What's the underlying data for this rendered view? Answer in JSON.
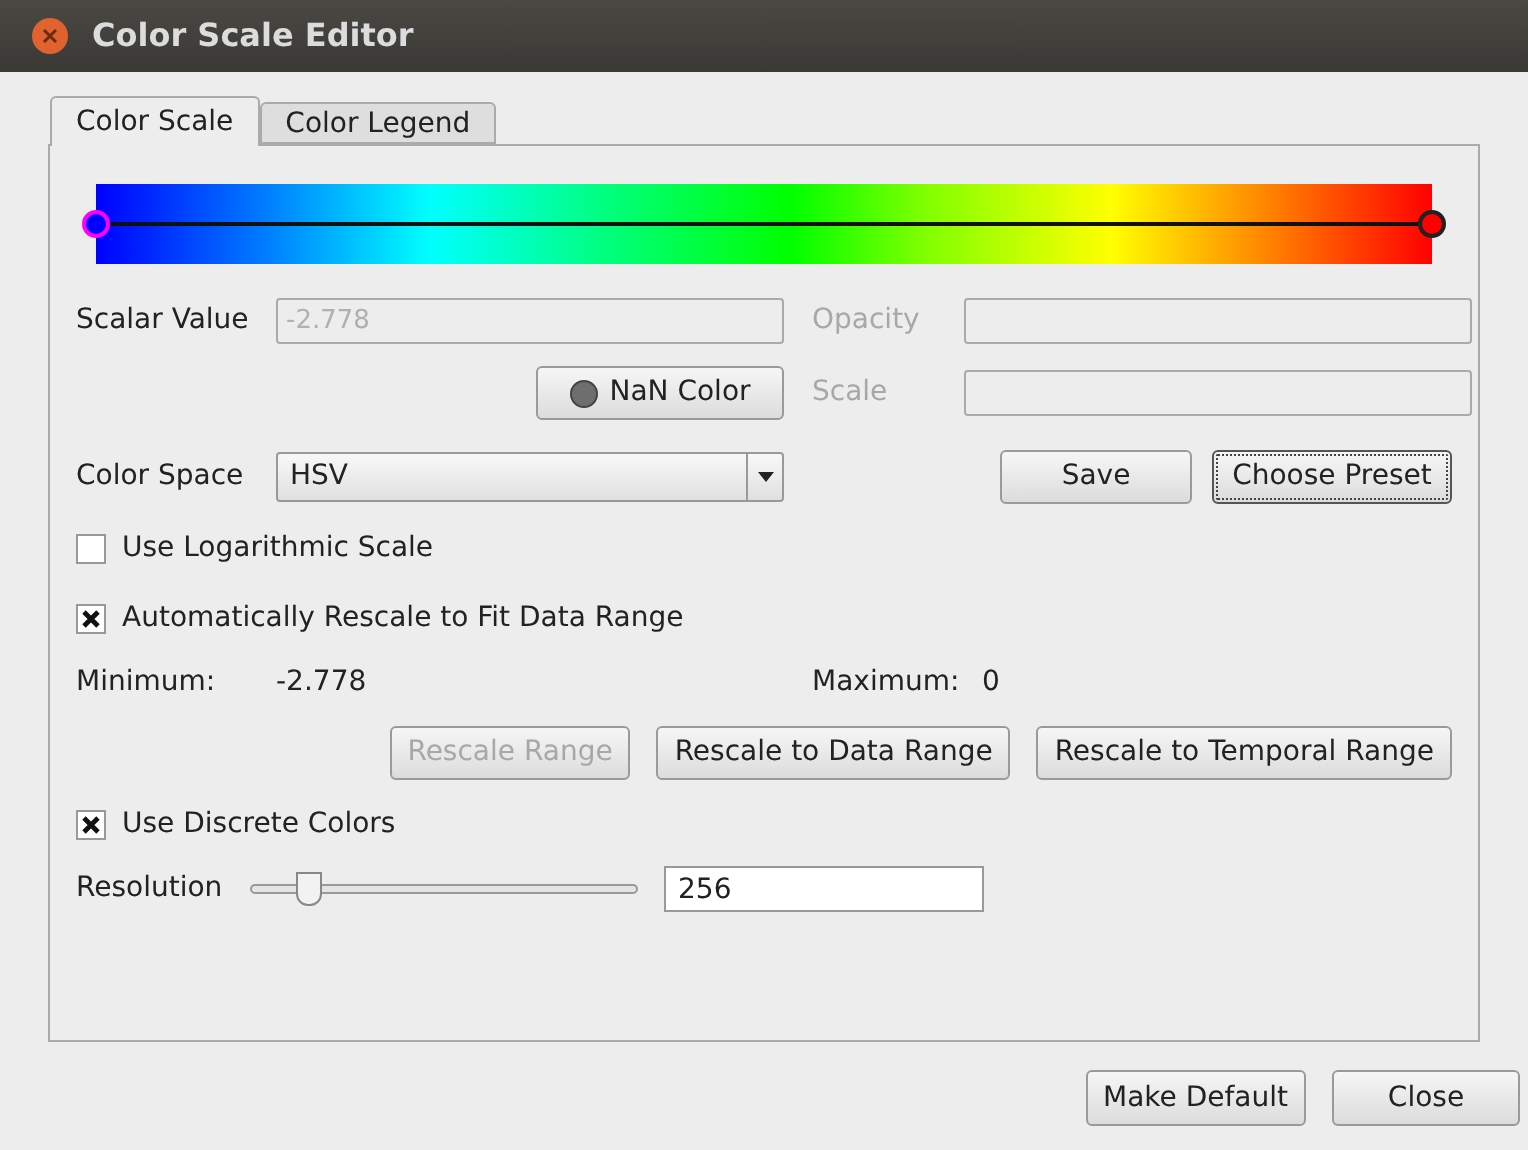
{
  "window": {
    "title": "Color Scale Editor"
  },
  "tabs": [
    {
      "label": "Color Scale",
      "selected": true
    },
    {
      "label": "Color Legend",
      "selected": false
    }
  ],
  "scalar_value": {
    "label": "Scalar Value",
    "value": "-2.778",
    "disabled": true
  },
  "opacity": {
    "label": "Opacity",
    "disabled": true
  },
  "nan_color_button": {
    "label": "NaN Color",
    "color": "#6e6e6e"
  },
  "scale": {
    "label": "Scale",
    "disabled": true
  },
  "color_space": {
    "label": "Color Space",
    "value": "HSV"
  },
  "save_button": "Save",
  "choose_preset_button": "Choose Preset",
  "checkboxes": [
    {
      "label": "Use Logarithmic Scale",
      "checked": false
    },
    {
      "label": "Automatically Rescale to Fit Data Range",
      "checked": true
    }
  ],
  "minimum": {
    "label": "Minimum:",
    "value": "-2.778"
  },
  "maximum": {
    "label": "Maximum:",
    "value": "0"
  },
  "range_buttons": [
    {
      "label": "Rescale Range",
      "disabled": true
    },
    {
      "label": "Rescale to Data Range",
      "disabled": false
    },
    {
      "label": "Rescale to Temporal Range",
      "disabled": false
    }
  ],
  "discrete_colors": {
    "label": "Use Discrete Colors",
    "checked": true
  },
  "resolution": {
    "label": "Resolution",
    "level": 0.15,
    "value": "256"
  },
  "footer_buttons": [
    "Make Default",
    "Close"
  ]
}
